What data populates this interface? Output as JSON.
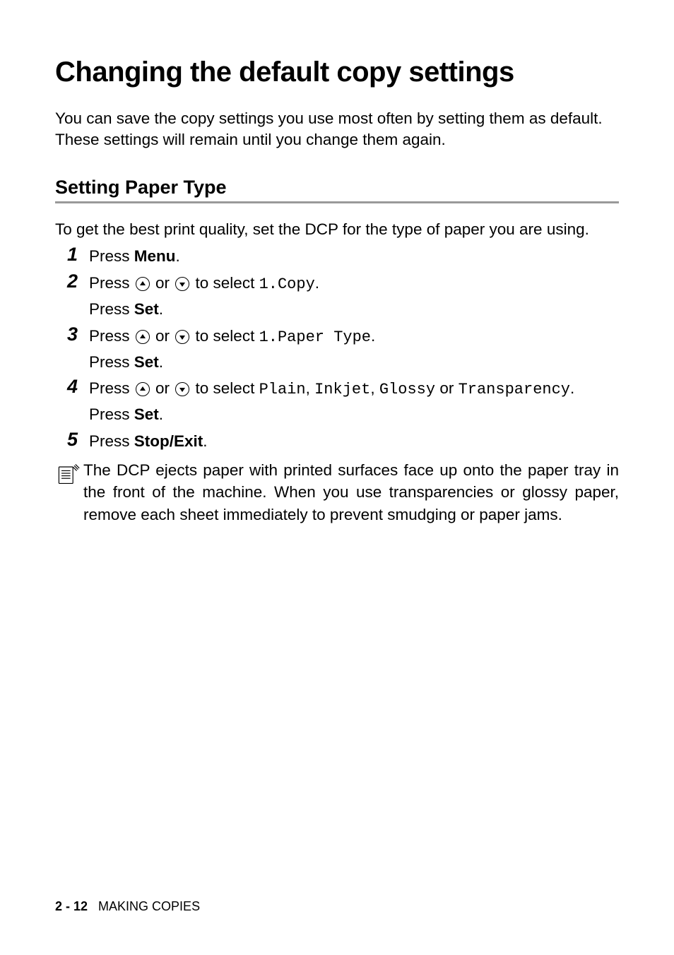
{
  "title": "Changing the default copy settings",
  "intro": "You can save the copy settings you use most often by setting them as default. These settings will remain until you change them again.",
  "section_heading": "Setting Paper Type",
  "section_intro": "To get the best print quality, set the DCP for the type of paper you are using.",
  "steps": [
    {
      "num": "1",
      "pre": "Press ",
      "bold1": "Menu",
      "post": "."
    },
    {
      "num": "2",
      "pre": "Press ",
      "mid": " or ",
      "post1": " to select ",
      "mono1": "1.Copy",
      "post2": ".",
      "line2_pre": "Press ",
      "line2_bold": "Set",
      "line2_post": "."
    },
    {
      "num": "3",
      "pre": "Press ",
      "mid": " or ",
      "post1": " to select ",
      "mono1": "1.Paper Type",
      "post2": ".",
      "line2_pre": "Press ",
      "line2_bold": "Set",
      "line2_post": "."
    },
    {
      "num": "4",
      "pre": "Press ",
      "mid": " or ",
      "post1": " to select ",
      "mono1": "Plain",
      "sep1": ", ",
      "mono2": "Inkjet",
      "sep2": ", ",
      "mono3": "Glossy",
      "post2": " or ",
      "mono4": "Transparency",
      "post3": ".",
      "line2_pre": "Press ",
      "line2_bold": "Set",
      "line2_post": "."
    },
    {
      "num": "5",
      "pre": "Press ",
      "bold1": "Stop/Exit",
      "post": "."
    }
  ],
  "note": "The DCP ejects paper with printed surfaces face up onto the paper tray in the front of the machine. When you use transparencies or glossy paper, remove each sheet immediately to prevent smudging or paper jams.",
  "footer": {
    "page": "2 - 12",
    "section": "MAKING COPIES"
  }
}
